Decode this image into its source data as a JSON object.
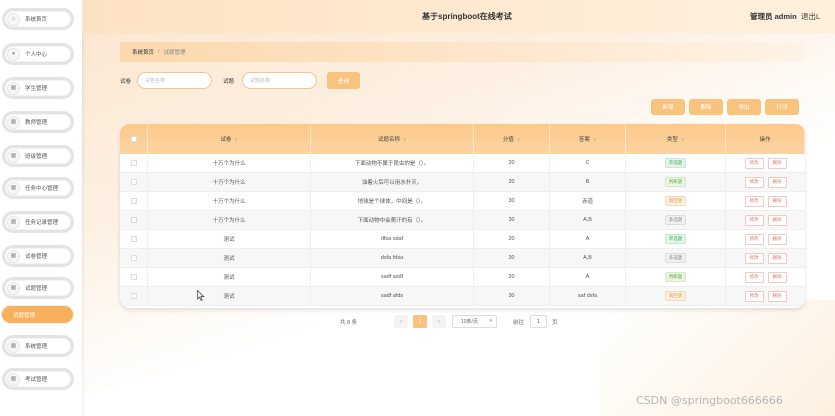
{
  "header": {
    "title": "基于springboot在线考试",
    "user": "管理员 admin",
    "logout": "退出L"
  },
  "sidebar": {
    "items": [
      {
        "label": "系统首页",
        "icon": "home-icon",
        "glyph": "⌂"
      },
      {
        "label": "个人中心",
        "icon": "user-icon",
        "glyph": "●"
      },
      {
        "label": "学生管理",
        "icon": "grid-icon",
        "glyph": "▦"
      },
      {
        "label": "教师管理",
        "icon": "grid-icon",
        "glyph": "▦"
      },
      {
        "label": "班级管理",
        "icon": "grid-icon",
        "glyph": "▦"
      },
      {
        "label": "任务中心管理",
        "icon": "grid-icon",
        "glyph": "▦"
      },
      {
        "label": "任务记录管理",
        "icon": "grid-icon",
        "glyph": "▦"
      },
      {
        "label": "试卷管理",
        "icon": "grid-icon",
        "glyph": "▦"
      },
      {
        "label": "试题管理",
        "icon": "grid-icon",
        "glyph": "▦"
      },
      {
        "label": "试题管理",
        "icon": "",
        "glyph": ""
      },
      {
        "label": "系统管理",
        "icon": "grid-icon",
        "glyph": "▦"
      },
      {
        "label": "考试管理",
        "icon": "grid-icon",
        "glyph": "▦"
      }
    ]
  },
  "breadcrumb": {
    "home": "系统首页",
    "separator": "/",
    "current": "试题管理"
  },
  "search": {
    "paper_label": "试卷",
    "paper_placeholder": "试卷名称",
    "question_label": "试题",
    "question_placeholder": "试题名称",
    "button": "查询"
  },
  "actions": {
    "add": "新增",
    "delete": "删除",
    "export": "导出",
    "print": "打印"
  },
  "table": {
    "headers": [
      "试卷",
      "试题名称",
      "分值",
      "答案",
      "类型",
      "操作"
    ],
    "rows": [
      {
        "paper": "十万个为什么",
        "question": "下面动物不属于昆虫的是（）。",
        "score": "20",
        "answer": "C",
        "type": "单选题",
        "type_class": "t-single"
      },
      {
        "paper": "十万个为什么",
        "question": "油着火后可以用水扑灭。",
        "score": "20",
        "answer": "B",
        "type": "判断题",
        "type_class": "t-judge"
      },
      {
        "paper": "十万个为什么",
        "question": "地球是个球体，中间是（）。",
        "score": "30",
        "answer": "赤道",
        "type": "填空题",
        "type_class": "t-fill"
      },
      {
        "paper": "十万个为什么",
        "question": "下面动物中会爬汗的有（）。",
        "score": "30",
        "answer": "A,B",
        "type": "多选题",
        "type_class": "t-multi"
      },
      {
        "paper": "测试",
        "question": "dfsa sdaf",
        "score": "20",
        "answer": "A",
        "type": "单选题",
        "type_class": "t-single"
      },
      {
        "paper": "测试",
        "question": "dsfa fdsa",
        "score": "30",
        "answer": "A,B",
        "type": "多选题",
        "type_class": "t-multi"
      },
      {
        "paper": "测试",
        "question": "sadf asdf",
        "score": "20",
        "answer": "A",
        "type": "判断题",
        "type_class": "t-judge"
      },
      {
        "paper": "测试",
        "question": "sadf afds",
        "score": "30",
        "answer": "saf dsfa",
        "type": "填空题",
        "type_class": "t-fill"
      }
    ],
    "edit": "修改",
    "delete": "删除"
  },
  "pagination": {
    "total": "共 8 条",
    "prev": "‹",
    "current": "1",
    "next": "›",
    "page_size": "10条/页",
    "goto": "前往",
    "goto_value": "1",
    "page_suffix": "页"
  },
  "watermark": "CSDN @springboot666666"
}
